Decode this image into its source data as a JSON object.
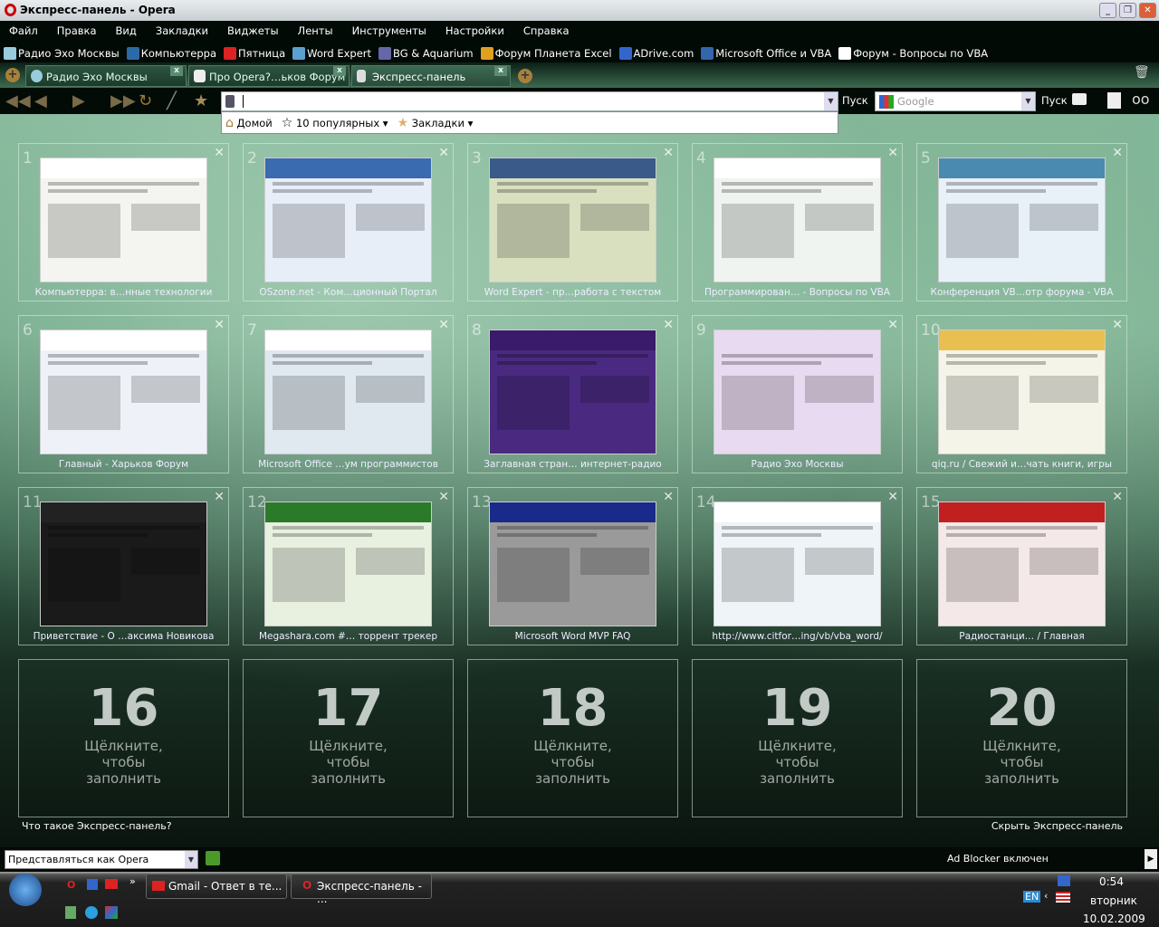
{
  "window": {
    "title": "Экспресс-панель - Opera"
  },
  "menu": [
    "Файл",
    "Правка",
    "Вид",
    "Закладки",
    "Виджеты",
    "Ленты",
    "Инструменты",
    "Настройки",
    "Справка"
  ],
  "bookmarks": [
    {
      "label": "Радио Эхо Москвы",
      "color": "#9cd"
    },
    {
      "label": "Компьютерра",
      "color": "#2a6aa8"
    },
    {
      "label": "Пятница",
      "color": "#d22"
    },
    {
      "label": "Word Expert",
      "color": "#5aa0d0"
    },
    {
      "label": "BG & Aquarium",
      "color": "#66a"
    },
    {
      "label": "Форум Планета Excel",
      "color": "#e0a020"
    },
    {
      "label": "ADrive.com",
      "color": "#36c"
    },
    {
      "label": "Microsoft Office и VBA",
      "color": "#36a"
    },
    {
      "label": "Форум - Вопросы по VBA",
      "color": "#fff"
    }
  ],
  "tabs": [
    {
      "label": "Радио Эхо Москвы",
      "active": false
    },
    {
      "label": "Про Opera?…ьков Форум",
      "active": false
    },
    {
      "label": "Экспресс-панель",
      "active": true
    }
  ],
  "toolbar": {
    "address_value": "",
    "go_label": "Пуск",
    "search_placeholder": "Google",
    "search_go_label": "Пуск"
  },
  "address_dropdown": {
    "home": "Домой",
    "top10": "10 популярных",
    "bookmarks": "Закладки"
  },
  "speed_dial": {
    "tiles": [
      {
        "n": "1",
        "caption": "Компьютерра: в…нные технологии",
        "thumb": "#f4f4f0",
        "hdr": "#fff"
      },
      {
        "n": "2",
        "caption": "OSzone.net - Ком…ционный Портал",
        "thumb": "#e8eef8",
        "hdr": "#3a6ab0"
      },
      {
        "n": "3",
        "caption": "Word Expert - пр…работа с текстом",
        "thumb": "#d8e0c0",
        "hdr": "#3a5a8a"
      },
      {
        "n": "4",
        "caption": "Программирован… - Вопросы по VBA",
        "thumb": "#f0f4f0",
        "hdr": "#fff"
      },
      {
        "n": "5",
        "caption": "Конференция VB…отр форума - VBA",
        "thumb": "#e8f0f8",
        "hdr": "#4a8ab0"
      },
      {
        "n": "6",
        "caption": "Главный - Харьков Форум",
        "thumb": "#eef2f8",
        "hdr": "#fff"
      },
      {
        "n": "7",
        "caption": "Microsoft Office …ум программистов",
        "thumb": "#e0e8f0",
        "hdr": "#fff"
      },
      {
        "n": "8",
        "caption": "Заглавная стран… интернет-радио",
        "thumb": "#4a2a80",
        "hdr": "#3a1a6a"
      },
      {
        "n": "9",
        "caption": "Радио Эхо Москвы",
        "thumb": "#e8daf0",
        "hdr": "#e8daf0"
      },
      {
        "n": "10",
        "caption": "qiq.ru / Свежий и…чать книги, игры",
        "thumb": "#f4f4e8",
        "hdr": "#e8c050"
      },
      {
        "n": "11",
        "caption": "Приветствие - О …аксима Новикова",
        "thumb": "#1a1a1a",
        "hdr": "#222"
      },
      {
        "n": "12",
        "caption": "Megashara.com #… торрент трекер",
        "thumb": "#e8f0e0",
        "hdr": "#2a7a2a"
      },
      {
        "n": "13",
        "caption": "Microsoft Word MVP FAQ",
        "thumb": "#9a9a9a",
        "hdr": "#1a2a8a"
      },
      {
        "n": "14",
        "caption": "http://www.citfor…ing/vb/vba_word/",
        "thumb": "#eef4f8",
        "hdr": "#fff"
      },
      {
        "n": "15",
        "caption": "Радиостанци… / Главная",
        "thumb": "#f4e8e8",
        "hdr": "#c02020"
      }
    ],
    "empty": [
      {
        "n": "16",
        "hint": "Щёлкните, чтобы заполнить"
      },
      {
        "n": "17",
        "hint": "Щёлкните, чтобы заполнить"
      },
      {
        "n": "18",
        "hint": "Щёлкните, чтобы заполнить"
      },
      {
        "n": "19",
        "hint": "Щёлкните, чтобы заполнить"
      },
      {
        "n": "20",
        "hint": "Щёлкните, чтобы заполнить"
      }
    ],
    "what_is": "Что такое Экспресс-панель?",
    "hide": "Скрыть Экспресс-панель"
  },
  "status": {
    "identify_as": "Представляться как Opera",
    "adblock": "Ad Blocker включен"
  },
  "taskbar": {
    "buttons": [
      "Gmail - Ответ в те...",
      "Экспресс-панель - ..."
    ],
    "lang": "EN",
    "time": "0:54",
    "day": "вторник",
    "date": "10.02.2009"
  }
}
